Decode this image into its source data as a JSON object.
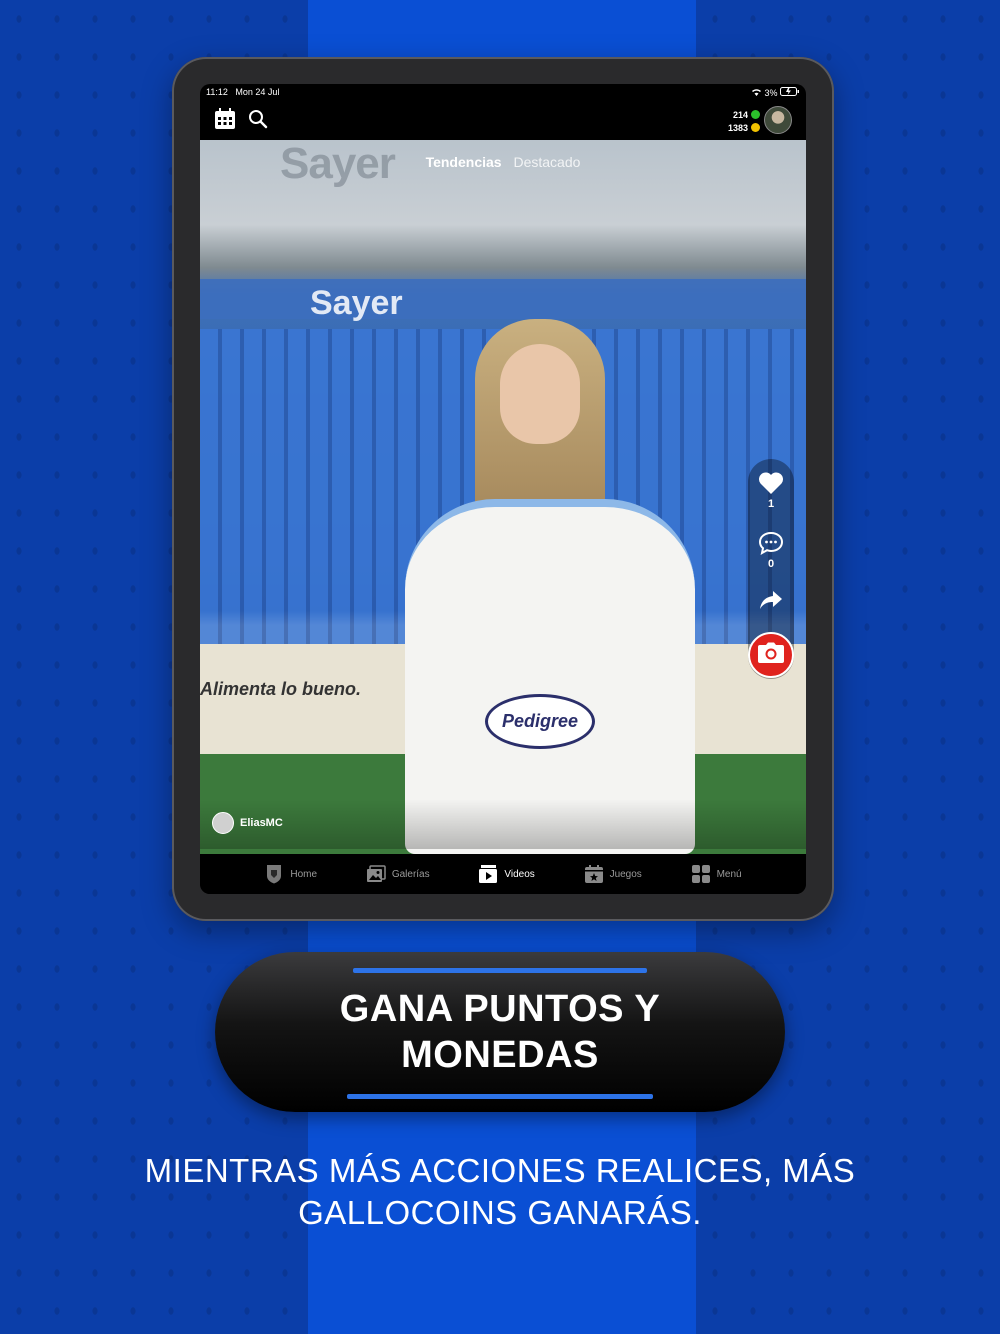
{
  "status_bar": {
    "time": "11:12",
    "date": "Mon 24 Jul",
    "battery": "3%"
  },
  "header": {
    "points": "214",
    "coins": "1383",
    "points_color": "#2bc12b",
    "coins_color": "#f2c200"
  },
  "feed_tabs": {
    "active": "Tendencias",
    "inactive": "Destacado"
  },
  "scene_text": {
    "sponsor_top": "Sayer",
    "sponsor_mid": "Sayer",
    "board": "Alimenta lo bueno.",
    "shirt_logo": "Pedigree"
  },
  "actions": {
    "likes": "1",
    "comments": "0"
  },
  "post": {
    "username": "EliasMC"
  },
  "nav": [
    {
      "label": "Home",
      "icon": "crest-icon"
    },
    {
      "label": "Galerías",
      "icon": "gallery-icon"
    },
    {
      "label": "Videos",
      "icon": "video-icon"
    },
    {
      "label": "Juegos",
      "icon": "games-icon"
    },
    {
      "label": "Menú",
      "icon": "menu-grid-icon"
    }
  ],
  "banner": {
    "line1": "GANA PUNTOS Y",
    "line2": "MONEDAS"
  },
  "caption": {
    "line1": "MIENTRAS MÁS ACCIONES REALICES, MÁS",
    "line2": "GALLOCOINS GANARÁS."
  },
  "colors": {
    "brand_blue": "#0a4fd4",
    "accent_blue": "#2d73e8",
    "camera_red": "#e0231e"
  }
}
